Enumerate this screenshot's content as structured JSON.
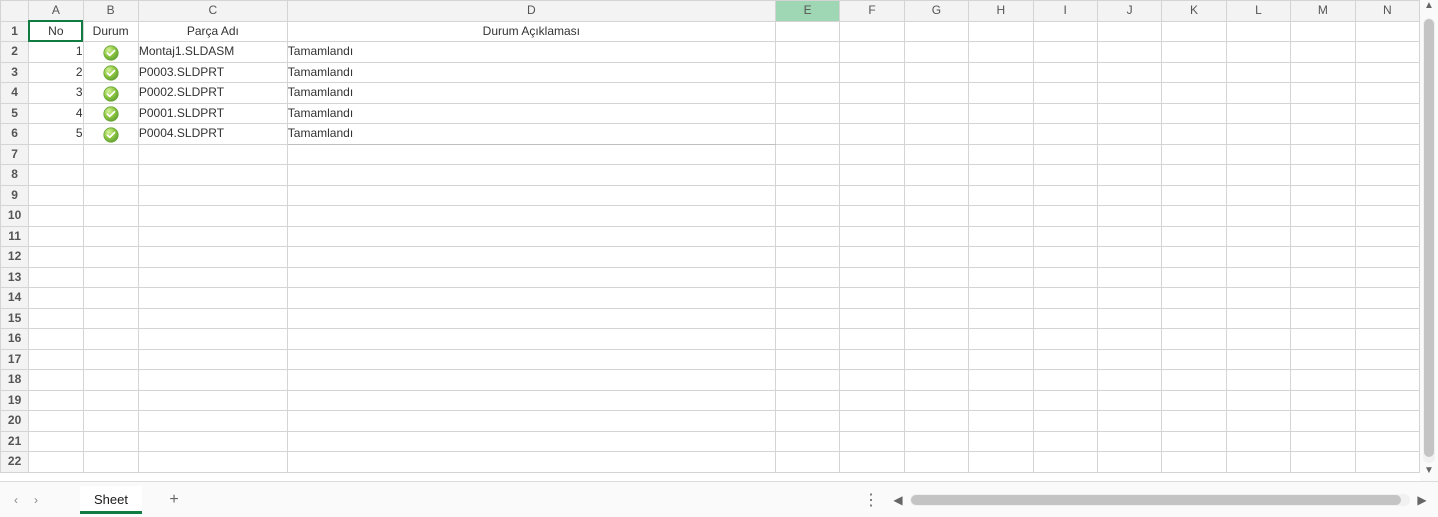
{
  "columns": [
    "A",
    "B",
    "C",
    "D",
    "E",
    "F",
    "G",
    "H",
    "I",
    "J",
    "K",
    "L",
    "M",
    "N"
  ],
  "column_widths": {
    "A": "cA",
    "B": "cB",
    "C": "cC",
    "D": "cD",
    "E": "cRest",
    "F": "cRest",
    "G": "cRest",
    "H": "cRest",
    "I": "cRest",
    "J": "cRest",
    "K": "cRest",
    "L": "cRest",
    "M": "cRest",
    "N": "cRest"
  },
  "selected_column": "E",
  "row_count": 22,
  "header_row": {
    "A": "No",
    "B": "Durum",
    "C": "Parça Adı",
    "D": "Durum Açıklaması"
  },
  "data_rows": [
    {
      "no": "1",
      "status": "ok",
      "part": "Montaj1.SLDASM",
      "desc": "Tamamlandı"
    },
    {
      "no": "2",
      "status": "ok",
      "part": "P0003.SLDPRT",
      "desc": "Tamamlandı"
    },
    {
      "no": "3",
      "status": "ok",
      "part": "P0002.SLDPRT",
      "desc": "Tamamlandı"
    },
    {
      "no": "4",
      "status": "ok",
      "part": "P0001.SLDPRT",
      "desc": "Tamamlandı"
    },
    {
      "no": "5",
      "status": "ok",
      "part": "P0004.SLDPRT",
      "desc": "Tamamlandı"
    }
  ],
  "sheet_tab": "Sheet",
  "icons": {
    "ok_title": "Completed"
  },
  "colors": {
    "accent": "#107c41",
    "sel_header": "#9fd7b5",
    "icon_fill": "#8cc63f",
    "icon_ring": "#6aa637"
  }
}
